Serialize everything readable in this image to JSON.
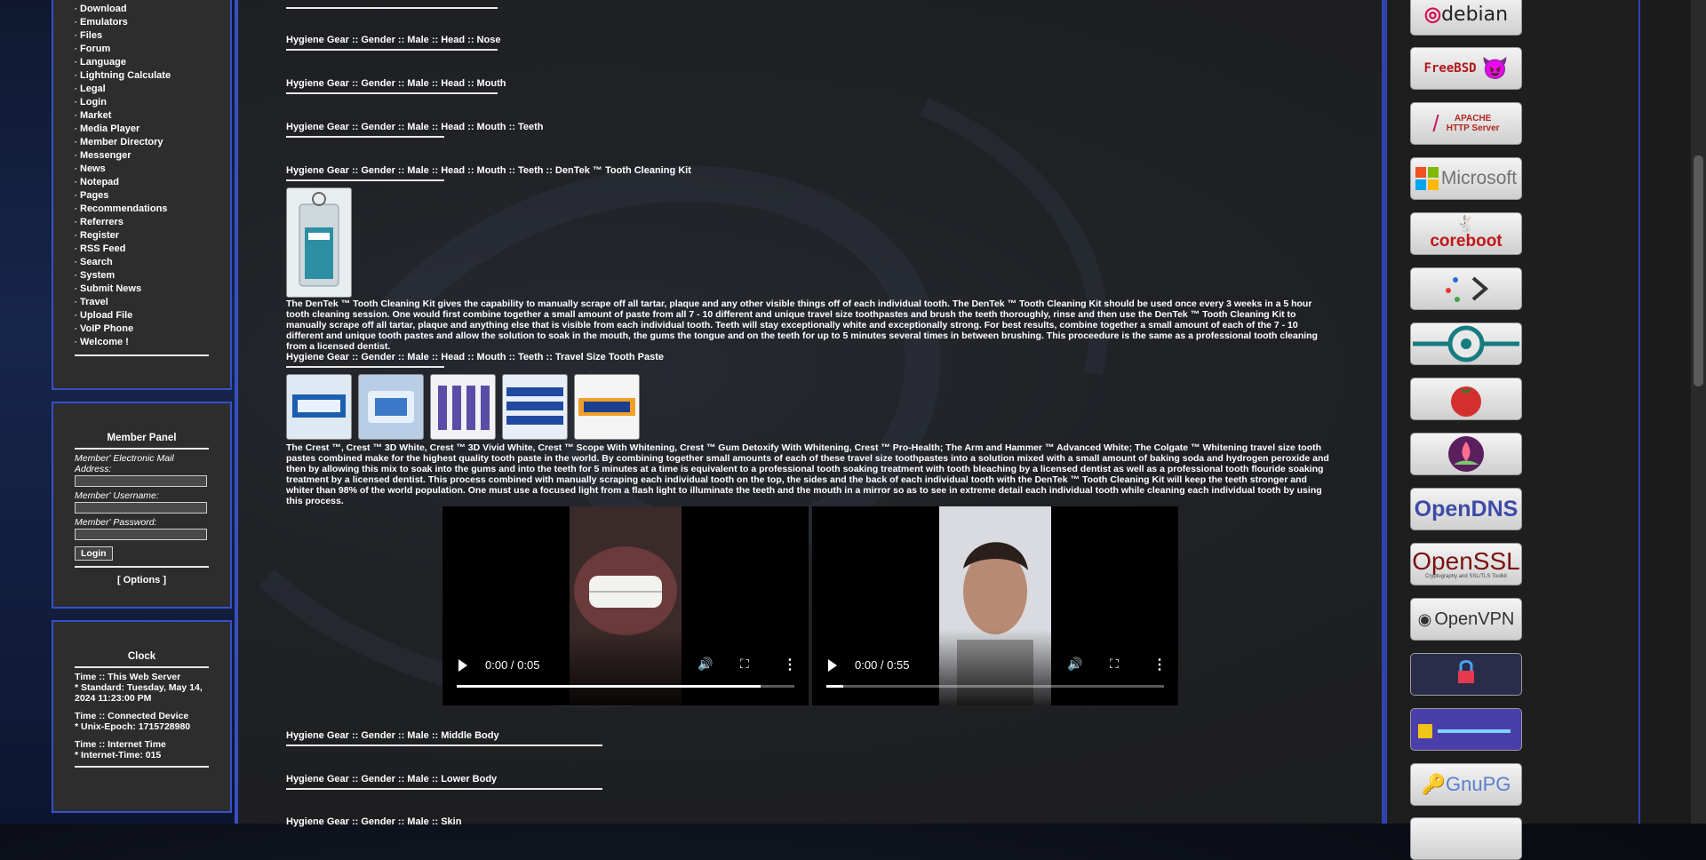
{
  "nav": {
    "items": [
      "Download",
      "Emulators",
      "Files",
      "Forum",
      "Language",
      "Lightning Calculate",
      "Legal",
      "Login",
      "Market",
      "Media Player",
      "Member Directory",
      "Messenger",
      "News",
      "Notepad",
      "Pages",
      "Recommendations",
      "Referrers",
      "Register",
      "RSS Feed",
      "Search",
      "System",
      "Submit News",
      "Travel",
      "Upload File",
      "VoIP Phone",
      "Welcome !"
    ]
  },
  "member_panel": {
    "title": "Member Panel",
    "email_label": "Member' Electronic Mail Address:",
    "username_label": "Member' Username:",
    "password_label": "Member' Password:",
    "login_label": "Login",
    "options_label": "[ Options ]"
  },
  "clock": {
    "title": "Clock",
    "web_server_title": "Time :: This Web Server",
    "web_server_value": "* Standard: Tuesday, May 14, 2024 11:23:00 PM",
    "device_title": "Time :: Connected Device",
    "device_value": "* Unix-Epoch: 1715728980",
    "internet_title": "Time :: Internet Time",
    "internet_value": "* Internet-Time: 015"
  },
  "main": {
    "headings": {
      "nose": "Hygiene Gear :: Gender :: Male :: Head :: Nose",
      "mouth": "Hygiene Gear :: Gender :: Male :: Head :: Mouth",
      "teeth": "Hygiene Gear :: Gender :: Male :: Head :: Mouth :: Teeth",
      "dentek": "Hygiene Gear :: Gender :: Male :: Head :: Mouth :: Teeth :: DenTek ™ Tooth Cleaning Kit",
      "toothpaste": "Hygiene Gear :: Gender :: Male :: Head :: Mouth :: Teeth :: Travel Size Tooth Paste",
      "middle_body": "Hygiene Gear :: Gender :: Male :: Middle Body",
      "lower_body": "Hygiene Gear :: Gender :: Male :: Lower Body",
      "skin": "Hygiene Gear :: Gender :: Male :: Skin"
    },
    "dentek_text": "The DenTek ™ Tooth Cleaning Kit gives the capability to manually scrape off all tartar, plaque and any other visible things off of each individual tooth. The DenTek ™ Tooth Cleaning Kit should be used once every 3 weeks in a 5 hour tooth cleaning session. One would first combine together a small amount of paste from all 7 - 10 different and unique travel size toothpastes and brush the teeth thoroughly, rinse and then use the DenTek ™ Tooth Cleaning Kit to manually scrape off all tartar, plaque and anything else that is visible from each individual tooth. Teeth will stay exceptionally white and exceptionally strong. For best results, combine together a small amount of each of the 7 - 10 different and unique tooth pastes and allow the solution to soak in the mouth, the gums the tongue and on the teeth for up to 5 minutes several times in between brushing. This proceedure is the same as a professional tooth cleaning from a licensed dentist.",
    "toothpaste_text": "The Crest ™, Crest ™ 3D White, Crest ™ 3D Vivid White, Crest ™ Scope With Whitening, Crest ™ Gum Detoxify With Whitening, Crest ™ Pro-Health; The Arm and Hammer ™ Advanced White; The Colgate ™ Whitening travel size tooth pastes combined make for the highest quality tooth paste in the world. By combining together small amounts of each of these travel size toothpastes into a solution mixed with a small amount of baking soda and hydrogen peroxide and then by allowing this mix to soak into the gums and into the teeth for 5 minutes at a time is equivalent to a professional tooth soaking treatment with tooth bleaching by a licensed dentist as well as a professional tooth flouride soaking treatment by a licensed dentist. This process combined with manually scraping each individual tooth on the top, the sides and the back of each individual tooth with the DenTek ™ Tooth Cleaning Kit will keep the teeth stronger and whiter than 98% of the world population. One must use a focused light from a flash light to illuminate the teeth and the mouth in a mirror so as to see in extreme detail each individual tooth while cleaning each individual tooth by using this process.",
    "videos": [
      {
        "time": "0:00 / 0:05",
        "progress": 0.9
      },
      {
        "time": "0:00 / 0:55",
        "progress": 0.05
      }
    ]
  },
  "sidebar_right": {
    "badges": [
      "debian",
      "FreeBSD",
      "APACHE HTTP Server",
      "Microsoft",
      "coreboot",
      "",
      "",
      "",
      "",
      "OpenDNS",
      "OpenSSL",
      "OpenVPN",
      "",
      "",
      "GnuPG"
    ],
    "openssl_sub": "Cryptography and SSL/TLS Toolkit"
  },
  "colors": {
    "accent_border": "#3550c8",
    "panel": "#2d2d2d"
  }
}
